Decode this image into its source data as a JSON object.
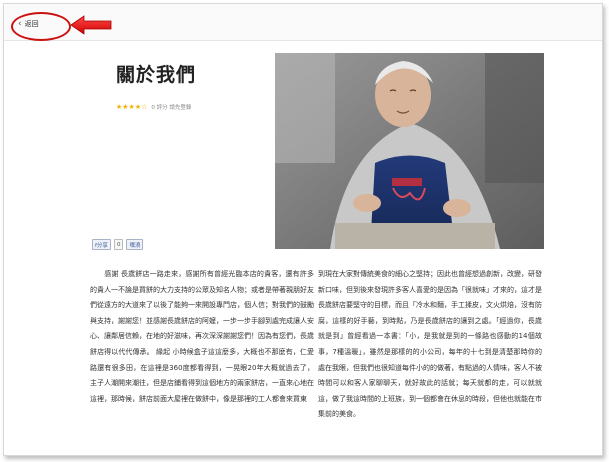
{
  "nav": {
    "back_label": "返回"
  },
  "page": {
    "title": "關於我們"
  },
  "rating": {
    "stars": "★★★★☆",
    "text": "0 評分 請先登錄"
  },
  "share": {
    "facebook_label": "f分享",
    "count_label": "0",
    "plurk_label": "噗浪"
  },
  "article": {
    "col_left": "　　感謝 長歲餅店一路走來，感謝所有曾經光臨本店的貴客，還有許多的貴人一不論是買餅的大力支持的公眾及知名人物；或者是帶著親朋好友們從遠方的大道來了以後了能夠一來開設專門店，個人信；對我們的鼓勵與支持，謝謝您！並感謝長歲餅店的阿嬤，一步一步手腳到處完成讓人安心、讓鄰居信賴，在地的好滋味，再次深深謝謝您們！因為有您們，長歲餅店得以代代傳承。 緣起 小時候盒子這這麼多，大概也不那麼有，仁愛路還有很多田，在這裡是360度都看得到，一晃眼20年大概就過去了，主子人潮開來潮往，但是店鋪看得到這個地方的兩家餅店，一直來心地在這裡，那時候，餅店前面大屋裡在做餅中，像是那裡的工人都會來買東",
    "col_right": "到現在大家對傳統美食的細心之堅持；因此也曾經想過創新，改變，研發新口味，但到後來發現許多客人喜愛的是因為「很就味」才來的，這才是長歲餅店要堅守的目標，而且「冷水和麵，手工揉皮，文火烘焙，沒有防腐，這樣的好手藝，到時點，乃是長歲餅店的讓到之處。「經過你，長歲就是到」曾經看過一本書：「小，是我就是到的一條路也感動的14個故事，7種溫暖」，雖然是那樣的的小公司，每年的十七到是清楚那時你的處在我眼，但我們也很知道每件小的的做著，有點過的人情味，客人不被時間可以和客人家聊聊天，就好故此的話就；每天就都的走，可以就就這，做了我這時間的上班族，到一個都會在休息的時段，但他也就能在市集前的美食。"
  }
}
